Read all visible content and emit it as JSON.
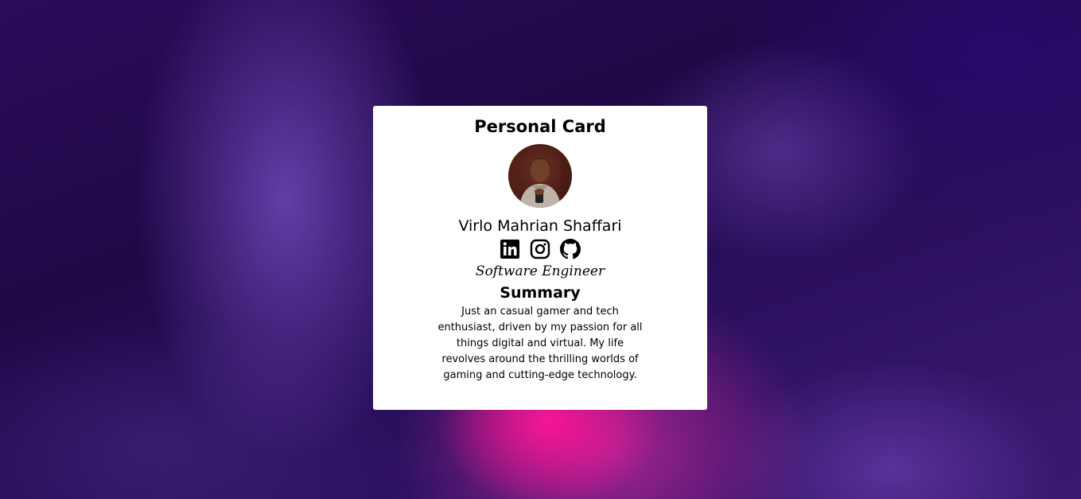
{
  "card": {
    "title": "Personal Card",
    "name": "Virlo Mahrian Shaffari",
    "job_title": "Software Engineer",
    "summary_heading": "Summary",
    "summary_text": "Just an casual gamer and tech enthusiast, driven by my passion for all things digital and virtual. My life revolves around the thrilling worlds of gaming and cutting-edge technology."
  },
  "avatar": {
    "icon": "profile-photo"
  },
  "socials": [
    {
      "icon": "linkedin-icon"
    },
    {
      "icon": "instagram-icon"
    },
    {
      "icon": "github-icon"
    }
  ],
  "colors": {
    "card_background": "#ffffff",
    "text": "#000000",
    "background_dark": "#1e0a45",
    "background_accent": "#ff1496"
  }
}
